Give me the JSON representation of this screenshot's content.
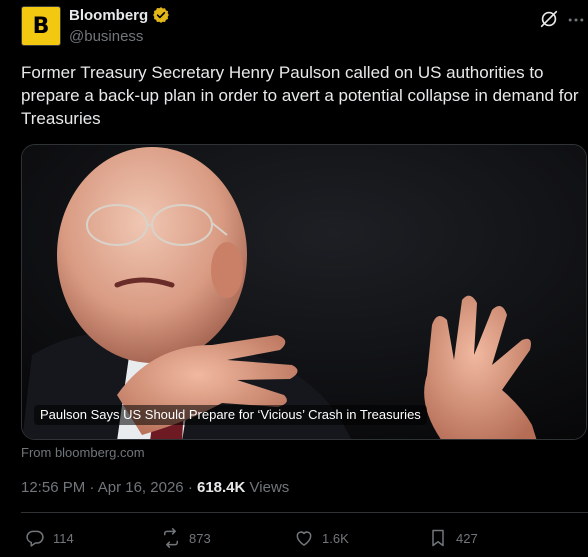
{
  "account": {
    "name": "Bloomberg",
    "handle": "@business",
    "avatar_letter": "B",
    "avatar_color": "#f2c811",
    "verified_color": "#e2b719"
  },
  "post": {
    "text": "Former Treasury Secretary Henry Paulson called on US authorities to prepare a back-up plan in order to avert a potential collapse in demand for Treasuries"
  },
  "card": {
    "headline": "Paulson Says US Should Prepare for ‘Vicious’ Crash in Treasuries",
    "source": "From bloomberg.com"
  },
  "meta": {
    "time": "12:56 PM",
    "separator": "·",
    "date": "Apr 16, 2026",
    "views_count": "618.4K",
    "views_label": "Views"
  },
  "actions": {
    "replies": "114",
    "reposts": "873",
    "likes": "1.6K",
    "bookmarks": "427"
  },
  "icons": [
    "verified-badge-icon",
    "grok-icon",
    "more-icon",
    "reply-icon",
    "repost-icon",
    "like-icon",
    "bookmark-icon"
  ]
}
